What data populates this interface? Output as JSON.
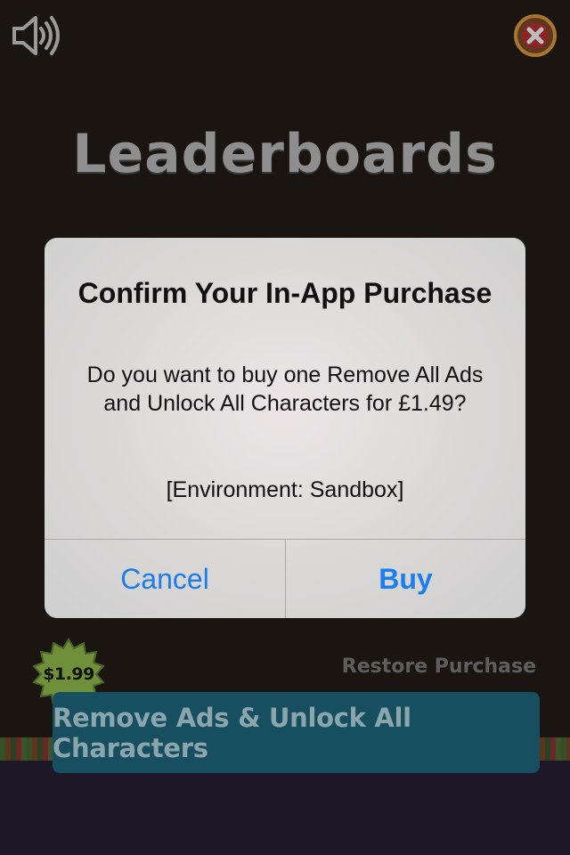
{
  "screen": {
    "title": "Leaderboards"
  },
  "controls": {
    "sound_icon": "speaker-icon",
    "close_icon": "close-icon"
  },
  "alert": {
    "title": "Confirm Your In-App Purchase",
    "message": "Do you want to buy one Remove All Ads and Unlock All Characters for £1.49?",
    "environment": "[Environment: Sandbox]",
    "cancel_label": "Cancel",
    "buy_label": "Buy",
    "button_color": "#1a7ef0"
  },
  "store": {
    "price_badge": "$1.99",
    "restore_label": "Restore Purchase",
    "remove_ads_label": "Remove Ads & Unlock All Characters",
    "accent_color": "#174f60"
  }
}
